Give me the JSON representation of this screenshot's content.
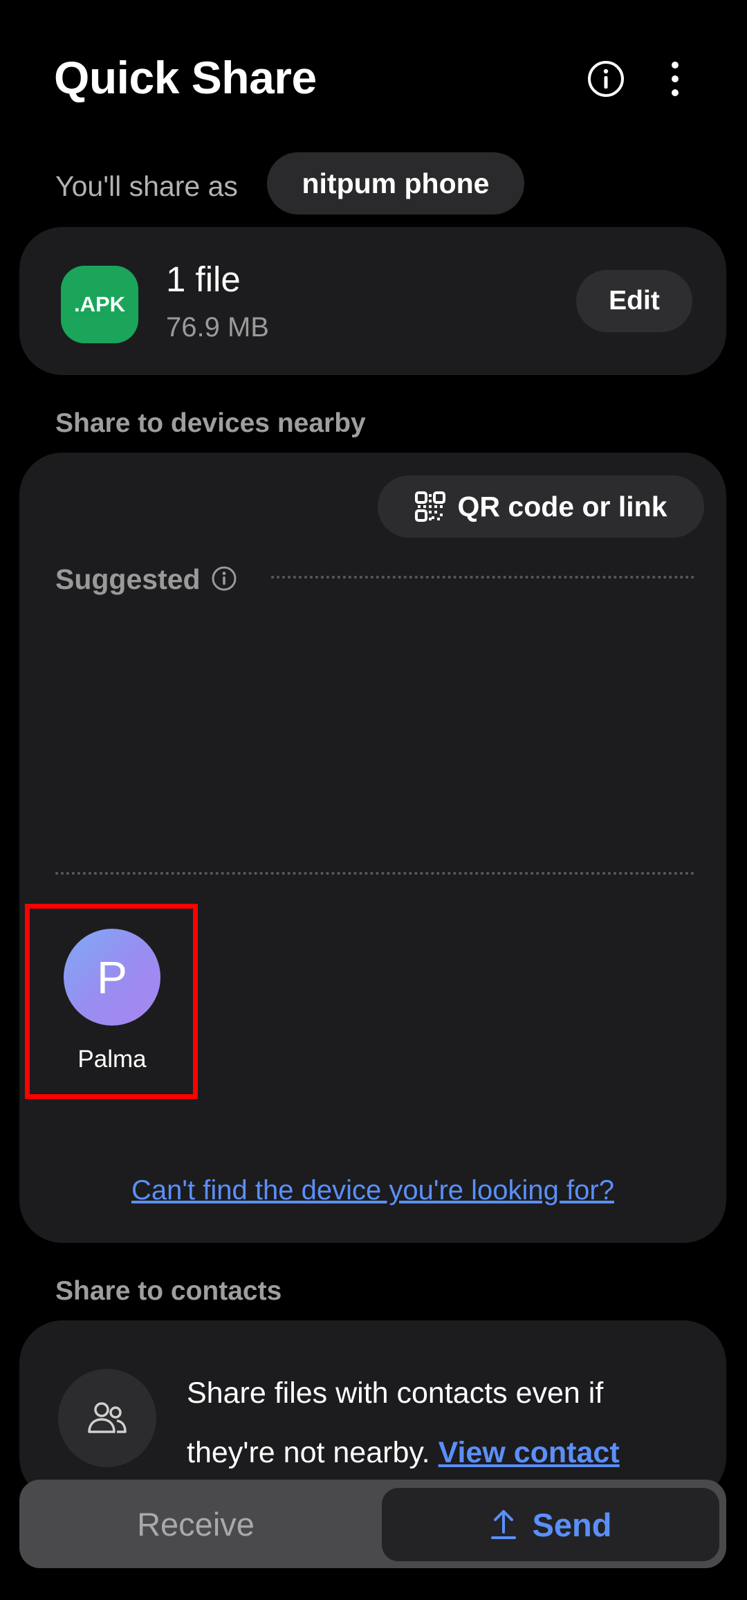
{
  "header": {
    "title": "Quick Share",
    "icons": [
      "info-icon",
      "more-options-icon"
    ]
  },
  "share_as": {
    "label": "You'll share as",
    "device_name": "nitpum phone"
  },
  "file_card": {
    "icon_text": ".APK",
    "count": "1 file",
    "size": "76.9 MB",
    "edit_label": "Edit",
    "icon_color": "#1aa55a"
  },
  "nearby": {
    "section_label": "Share to devices nearby",
    "qr_button_label": "QR code or link",
    "suggested_label": "Suggested",
    "devices": [
      {
        "initial": "P",
        "name": "Palma"
      }
    ],
    "cant_find_link": "Can't find the device you're looking for?"
  },
  "contacts": {
    "section_label": "Share to contacts",
    "text": "Share files with contacts even if they're not nearby.",
    "link": "View contact"
  },
  "bottom_tabs": {
    "receive": "Receive",
    "send": "Send",
    "selected": "send"
  },
  "colors": {
    "background": "#000000",
    "card": "#1c1c1e",
    "accent_link": "#5b8ff9",
    "highlight": "#ff0000"
  }
}
